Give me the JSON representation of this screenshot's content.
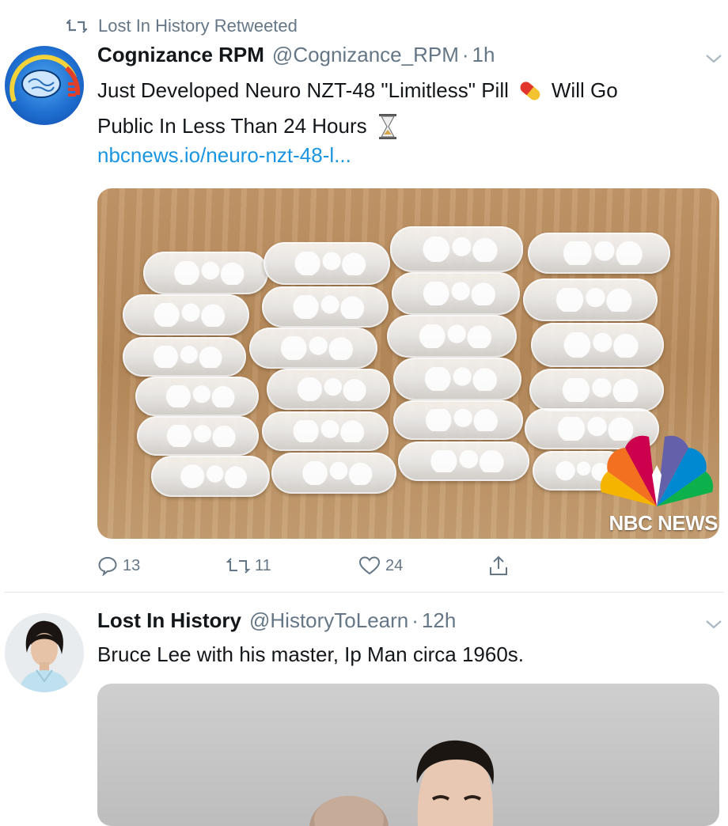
{
  "retweet_header": {
    "text": "Lost In History Retweeted"
  },
  "tweets": [
    {
      "display_name": "Cognizance RPM",
      "handle": "@Cognizance_RPM",
      "separator": "·",
      "time": "1h",
      "text_line1": "Just Developed Neuro NZT-48 \"Limitless\" Pill",
      "text_line1_end": "Will Go",
      "text_line2": "Public In Less Than 24 Hours",
      "link": "nbcnews.io/neuro-nzt-48-l...",
      "media_watermark": "NBC NEWS",
      "replies": "13",
      "retweets": "11",
      "likes": "24"
    },
    {
      "display_name": "Lost In History",
      "handle": "@HistoryToLearn",
      "separator": "·",
      "time": "12h",
      "text": "Bruce Lee with his master, Ip Man circa 1960s."
    }
  ],
  "icons": {
    "retweet": "retweet-icon",
    "chevron": "chevron-down-icon",
    "reply": "reply-icon",
    "like": "heart-icon",
    "share": "share-icon",
    "pill": "pill-emoji",
    "hourglass": "hourglass-emoji"
  },
  "colors": {
    "link": "#1b95e0",
    "secondary": "#657786",
    "divider": "#e1e8ed"
  }
}
